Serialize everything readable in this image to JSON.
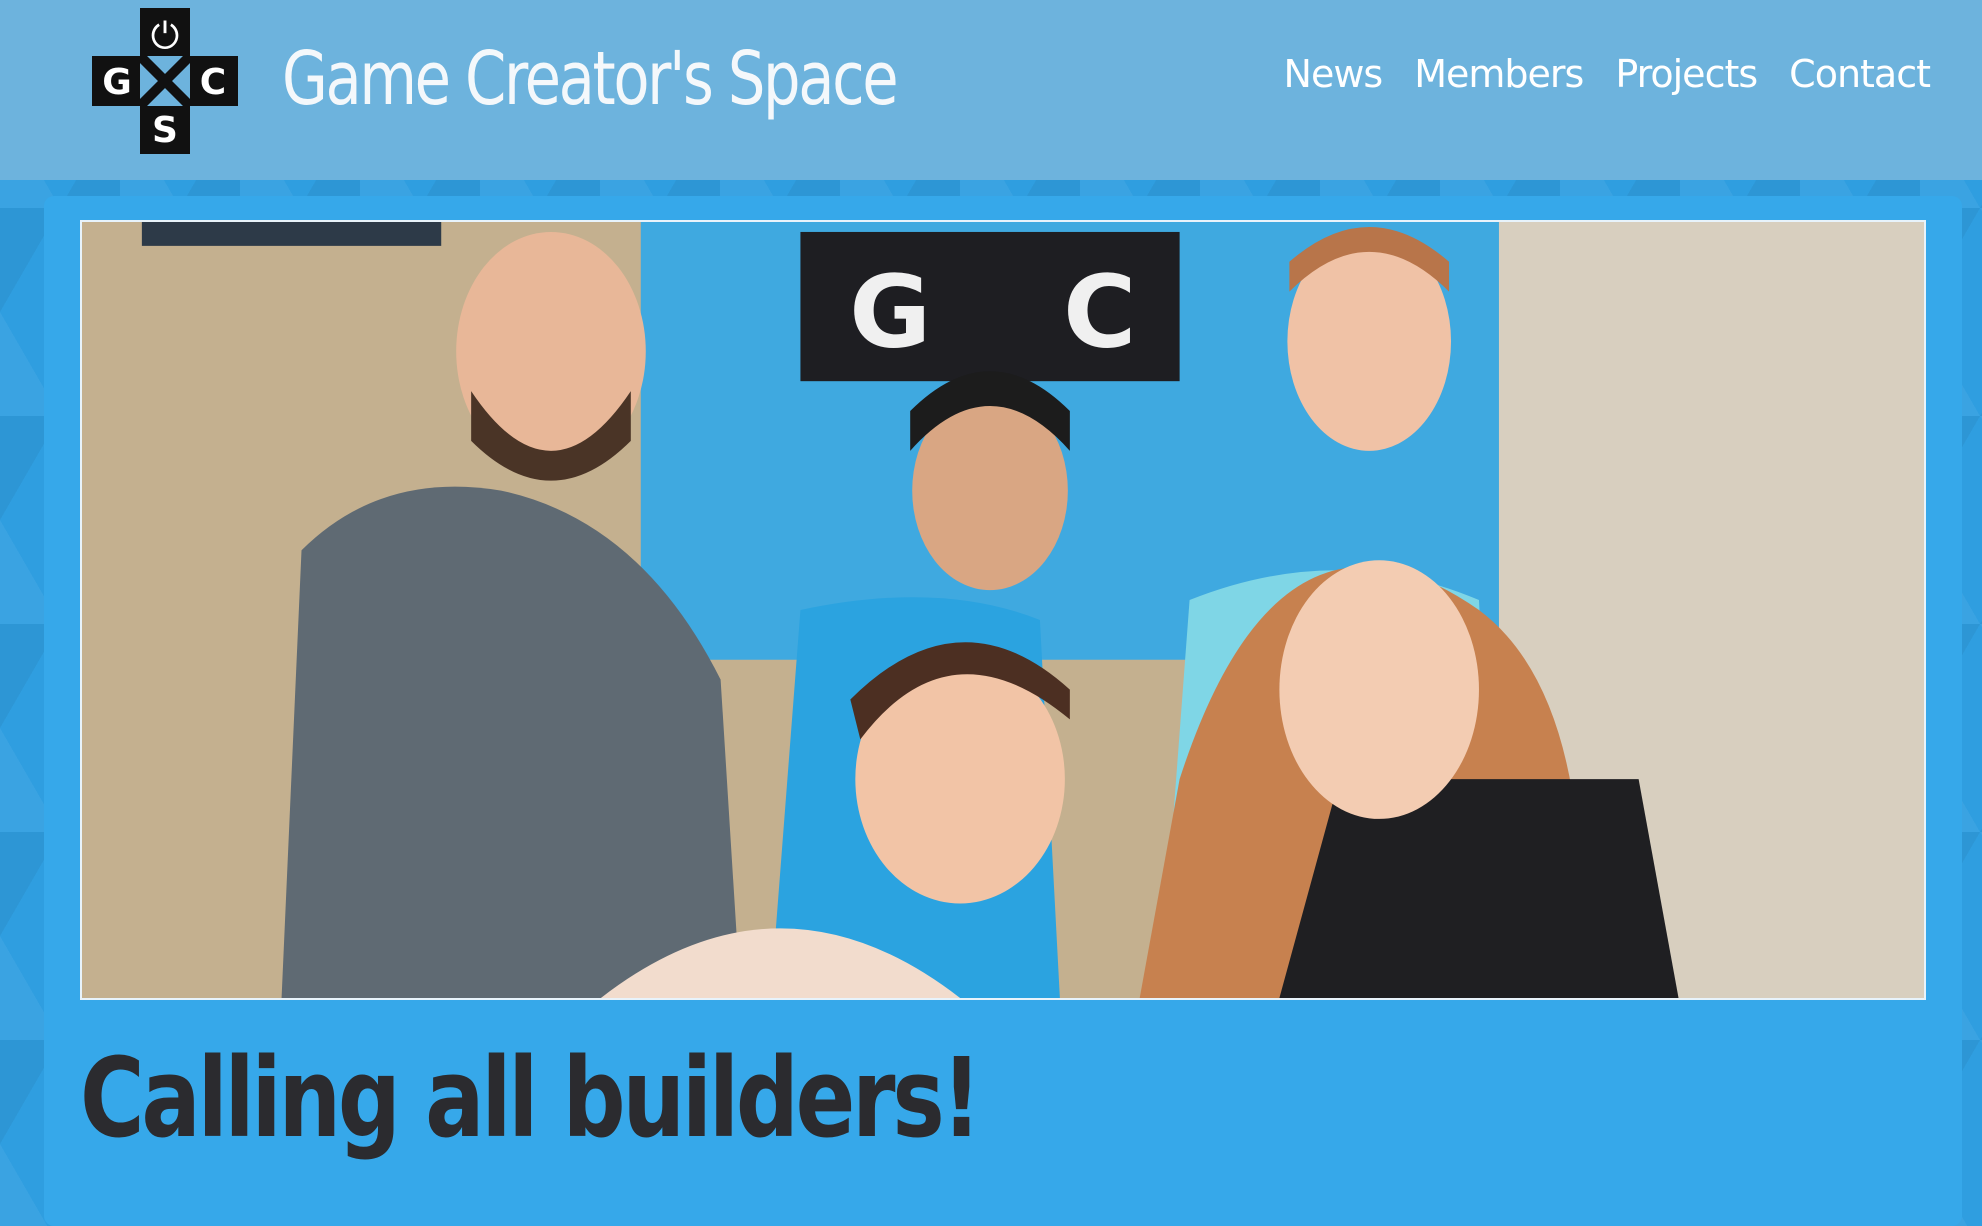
{
  "header": {
    "logo_letters": {
      "top": "⏻",
      "left": "G",
      "right": "C",
      "bottom": "S"
    },
    "title": "Game Creator's Space",
    "nav": [
      {
        "label": "News"
      },
      {
        "label": "Members"
      },
      {
        "label": "Projects"
      },
      {
        "label": "Contact"
      }
    ]
  },
  "hero": {
    "sign_letters": {
      "left": "G",
      "right": "C"
    }
  },
  "main": {
    "headline": "Calling all builders!"
  },
  "colors": {
    "header_bg": "#6db3dd",
    "page_bg": "#2f9ee0",
    "card_bg": "#36a8ea",
    "headline_text": "#2b2b2f",
    "nav_text": "#ffffff"
  }
}
